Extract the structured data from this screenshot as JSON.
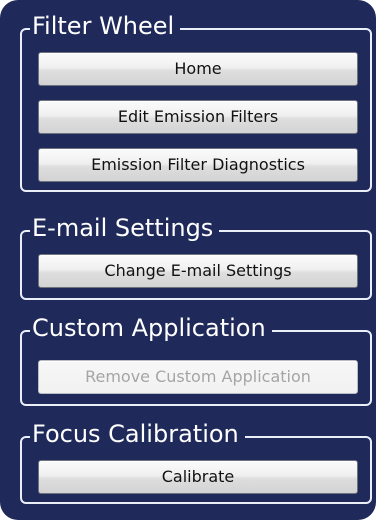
{
  "groups": {
    "filter_wheel": {
      "title": "Filter Wheel",
      "buttons": [
        "Home",
        "Edit Emission Filters",
        "Emission Filter Diagnostics"
      ]
    },
    "email_settings": {
      "title": "E-mail Settings",
      "buttons": [
        "Change E-mail Settings"
      ]
    },
    "custom_application": {
      "title": "Custom Application",
      "buttons": [
        "Remove Custom Application"
      ],
      "remove_enabled": false
    },
    "focus_calibration": {
      "title": "Focus Calibration",
      "buttons": [
        "Calibrate"
      ]
    }
  },
  "colors": {
    "panel_background": "#1f2a5b",
    "group_border": "#e9eef8",
    "title_text": "#ffffff",
    "disabled_text": "#a5a5a5"
  }
}
